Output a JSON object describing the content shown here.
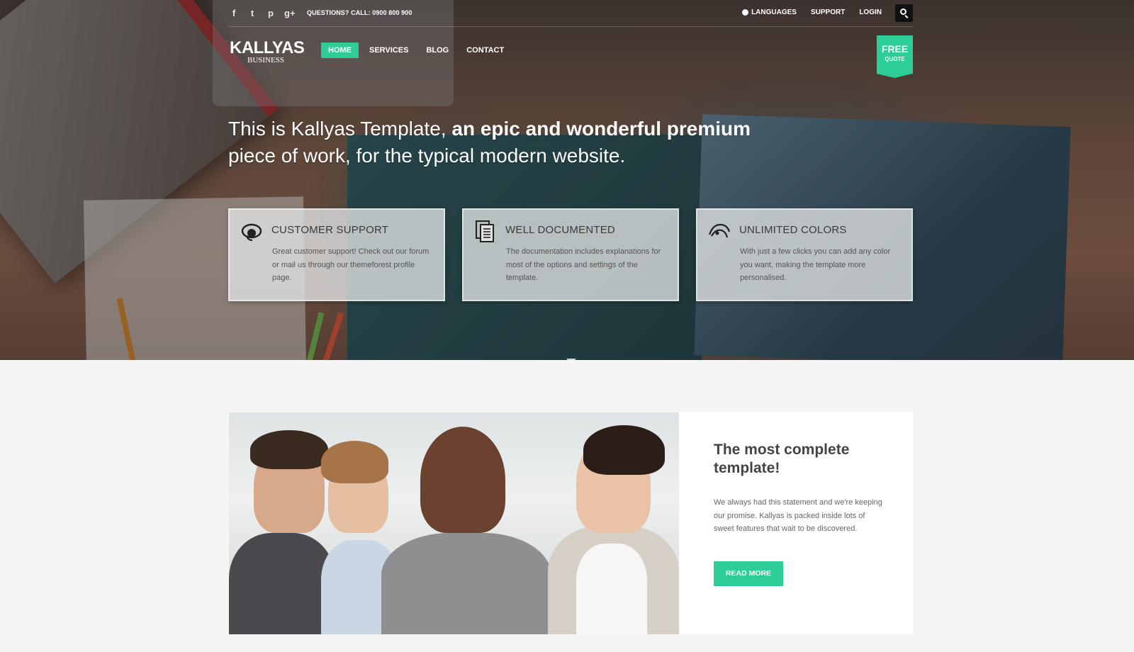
{
  "colors": {
    "accent": "#2ecc96",
    "dark": "#111111"
  },
  "topbar": {
    "social": [
      {
        "name": "facebook-icon",
        "glyph": "f"
      },
      {
        "name": "twitter-icon",
        "glyph": "t"
      },
      {
        "name": "pinterest-icon",
        "glyph": "p"
      },
      {
        "name": "google-plus-icon",
        "glyph": "g+"
      }
    ],
    "phone_label": "QUESTIONS? CALL:",
    "phone_number": "0900 800 900",
    "links": {
      "languages": "LANGUAGES",
      "support": "SUPPORT",
      "login": "LOGIN"
    }
  },
  "header": {
    "logo_main": "KALLYAS",
    "logo_sub": "BUSINESS",
    "nav": [
      "HOME",
      "SERVICES",
      "BLOG",
      "CONTACT"
    ],
    "nav_active": "HOME",
    "free_quote": {
      "top": "FREE",
      "bottom": "QUOTE"
    }
  },
  "hero": {
    "heading_light": "This is Kallyas Template, ",
    "heading_bold": "an epic and wonderful premium",
    "heading_rest": "piece of work, for the typical modern website.",
    "features": [
      {
        "icon": "headset-icon",
        "title": "CUSTOMER SUPPORT",
        "text": "Great customer support! Check out our forum or mail us through our themeforest profile page."
      },
      {
        "icon": "documents-icon",
        "title": "WELL DOCUMENTED",
        "text": "The documentation includes explanations for most of the options and settings of the template."
      },
      {
        "icon": "color-hand-icon",
        "title": "UNLIMITED COLORS",
        "text": "With just a few clicks you can add any color you want, making the template more personalised."
      }
    ]
  },
  "content": {
    "title": "The most complete template!",
    "text": "We always had this statement and we're keeping our promise. Kallyas is packed inside lots of sweet features that wait to be discovered.",
    "button": "READ MORE"
  }
}
